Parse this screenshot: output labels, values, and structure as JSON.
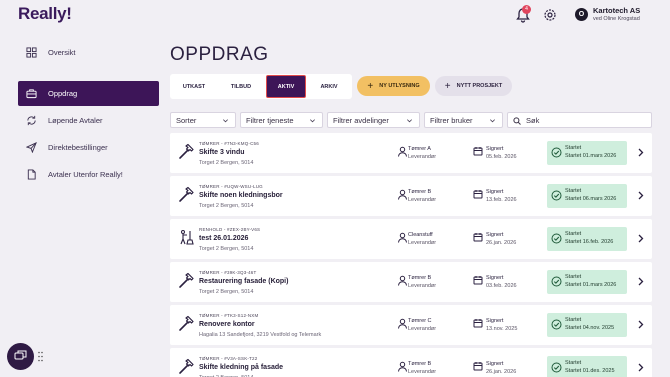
{
  "app": {
    "logo": "Really!",
    "notification_count": "4",
    "company": "Kartotech AS",
    "user": "ved Oline Krogstad",
    "avatar_letter": "O"
  },
  "sidebar": {
    "items": [
      {
        "label": "Oversikt",
        "icon": "grid-icon"
      },
      {
        "label": "Oppdrag",
        "icon": "briefcase-icon",
        "active": true
      },
      {
        "label": "Løpende Avtaler",
        "icon": "refresh-icon"
      },
      {
        "label": "Direktebestillinger",
        "icon": "send-icon"
      },
      {
        "label": "Avtaler Utenfor Really!",
        "icon": "document-icon"
      }
    ]
  },
  "page": {
    "title": "OPPDRAG",
    "tabs": [
      "UTKAST",
      "TILBUD",
      "AKTIV",
      "ARKIV"
    ],
    "active_tab": "AKTIV",
    "new_button": "NY UTLYSNING",
    "project_button": "NYTT PROSJEKT"
  },
  "filters": {
    "sort": "Sorter",
    "service": "Filtrer tjeneste",
    "department": "Filtrer avdelinger",
    "user": "Filtrer bruker",
    "search_placeholder": "Søk"
  },
  "jobs": [
    {
      "code": "TØMRER - #7N3-KMQ-C56",
      "title": "Skifte 3 vindu",
      "address": "Torget 2 Bergen, 5014",
      "provider": "Tømrer A",
      "role": "Leverandør",
      "signed_label": "Signert",
      "signed_date": "05.feb. 2026",
      "status": "Startet",
      "status_date": "Startet 01.mars 2026",
      "icon": "hammer-icon"
    },
    {
      "code": "TØMRER - #UQW-WSU-LUG",
      "title": "Skifte noen kledningsbor",
      "address": "Torget 2 Bergen, 5014",
      "provider": "Tømrer B",
      "role": "Leverandør",
      "signed_label": "Signert",
      "signed_date": "13.feb. 2026",
      "status": "Startet",
      "status_date": "Startet 06.mars 2026",
      "icon": "hammer-icon"
    },
    {
      "code": "RENHOLD - #ZEX-2BY-V6S",
      "title": "test 26.01.2026",
      "address": "Torget 2 Bergen, 5014",
      "provider": "Cleanstuff",
      "role": "Leverandør",
      "signed_label": "Signert",
      "signed_date": "26.jan. 2026",
      "status": "Startet",
      "status_date": "Startet 16.feb. 2026",
      "icon": "cleaning-icon"
    },
    {
      "code": "TØMRER - #39K-3Q3-46T",
      "title": "Restaurering fasade (Kopi)",
      "address": "Torget 2 Bergen, 5014",
      "provider": "Tømrer B",
      "role": "Leverandør",
      "signed_label": "Signert",
      "signed_date": "03.feb. 2026",
      "status": "Startet",
      "status_date": "Startet 01.mars 2026",
      "icon": "hammer-icon"
    },
    {
      "code": "TØMRER - #TK3-S12-NXM",
      "title": "Renovere kontor",
      "address": "Hagalia 13 Sandefjord, 3219 Vestfold og Telemark",
      "provider": "Tømrer C",
      "role": "Leverandør",
      "signed_label": "Signert",
      "signed_date": "13.nov. 2025",
      "status": "Startet",
      "status_date": "Startet 04.nov. 2025",
      "icon": "hammer-icon"
    },
    {
      "code": "TØMRER - #V3A-SSK-T22",
      "title": "Skifte kledning på fasade",
      "address": "Torget 2 Bergen, 5014",
      "provider": "Tømrer B",
      "role": "Leverandør",
      "signed_label": "Signert",
      "signed_date": "26.jan. 2026",
      "status": "Startet",
      "status_date": "Startet 01.des. 2025",
      "icon": "hammer-icon"
    }
  ],
  "colors": {
    "brand": "#3d1558",
    "accent": "#f2c063",
    "status_bg": "#cfeedd",
    "badge": "#e0455d"
  }
}
